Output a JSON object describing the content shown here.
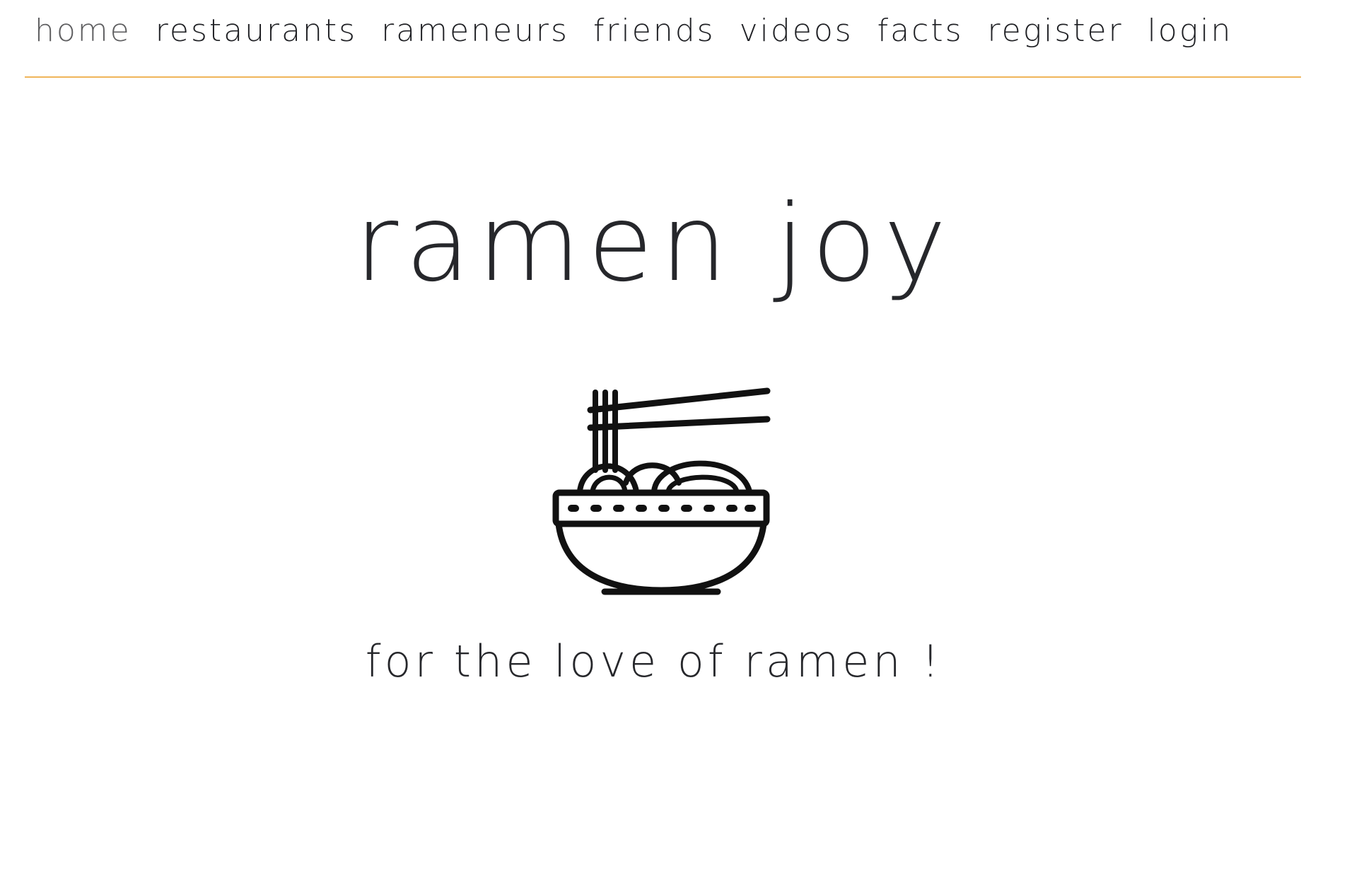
{
  "nav": {
    "items": [
      {
        "label": "home",
        "active": true
      },
      {
        "label": "restaurants",
        "active": false
      },
      {
        "label": "rameneurs",
        "active": false
      },
      {
        "label": "friends",
        "active": false
      },
      {
        "label": "videos",
        "active": false
      },
      {
        "label": "facts",
        "active": false
      },
      {
        "label": "register",
        "active": false
      },
      {
        "label": "login",
        "active": false
      }
    ]
  },
  "hero": {
    "title": "ramen joy",
    "tagline": "for the love of ramen !",
    "icon": "ramen-bowl-icon"
  },
  "colors": {
    "text": "#26272b",
    "active_nav": "#5e5e60",
    "divider": "#f0b55a",
    "background": "#ffffff"
  }
}
